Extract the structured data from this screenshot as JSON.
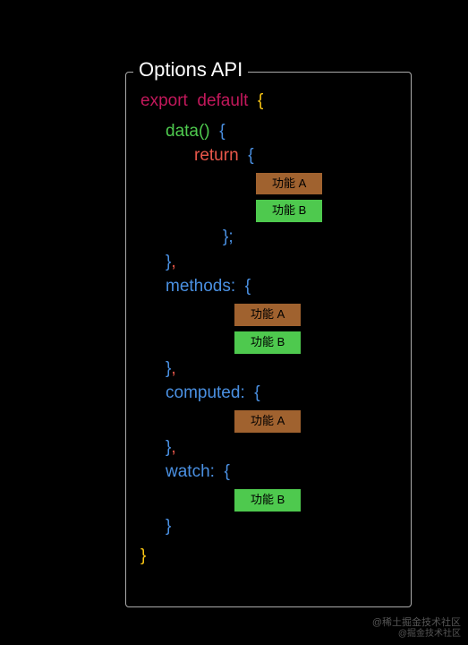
{
  "header": {
    "title": "Options API"
  },
  "code": {
    "export": "export",
    "default": "default",
    "brace_open": "{",
    "brace_close": "}",
    "data": "data",
    "parens": "()",
    "return": "return",
    "semi": ";",
    "comma": ",",
    "methods": "methods:",
    "computed": "computed:",
    "watch": "watch:"
  },
  "tags": {
    "featureA": "功能 A",
    "featureB": "功能 B"
  },
  "watermark": {
    "line1": "@稀土掘金技术社区",
    "line2": "@掘金技术社区"
  }
}
